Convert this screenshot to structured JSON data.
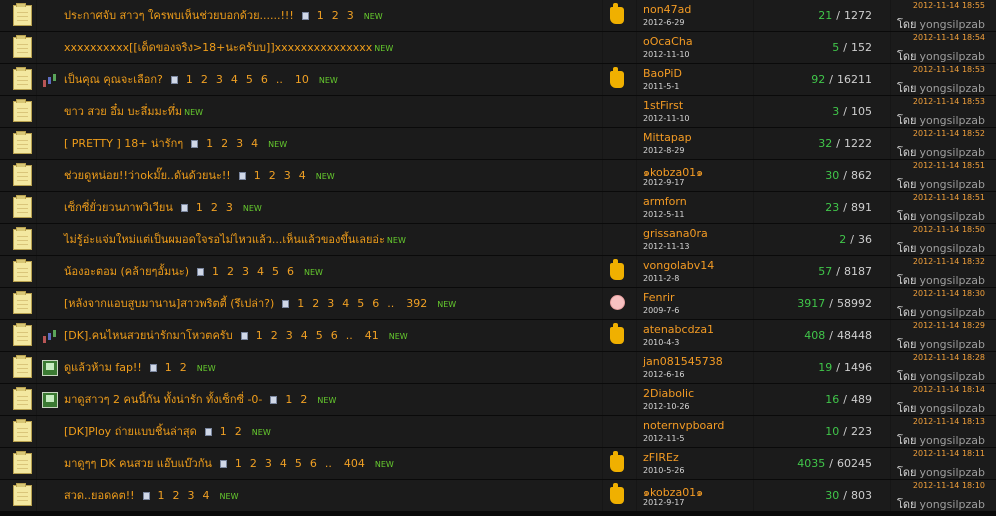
{
  "labels": {
    "by": "โดย",
    "new": "NEW",
    "sep": "/",
    "dots": ".."
  },
  "threads": [
    {
      "title": "ประกาศจับ สาวๆ ใครพบเห็นช่วยบอกด้วย......!!!",
      "pages": [
        "1",
        "2",
        "3"
      ],
      "more_page": "",
      "badge": "",
      "pin": "thumb",
      "author": "non47ad",
      "author_date": "2012-6-29",
      "replies": "21",
      "views": "1272",
      "last_date": "2012-11-14 18:55",
      "last_user": "yongsilpzab"
    },
    {
      "title": "xxxxxxxxxx[[เด็ดของจริง>18+นะครับบ]]xxxxxxxxxxxxxxx",
      "pages": [],
      "more_page": "",
      "badge": "",
      "pin": "",
      "author": "oOcaCha",
      "author_date": "2012-11-10",
      "replies": "5",
      "views": "152",
      "last_date": "2012-11-14 18:54",
      "last_user": "yongsilpzab"
    },
    {
      "title": "เป็นคุณ คุณจะเลือก?",
      "pages": [
        "1",
        "2",
        "3",
        "4",
        "5",
        "6"
      ],
      "more_page": "10",
      "badge": "chart",
      "pin": "thumb",
      "author": "BaoPiD",
      "author_date": "2011-5-1",
      "replies": "92",
      "views": "16211",
      "last_date": "2012-11-14 18:53",
      "last_user": "yongsilpzab"
    },
    {
      "title": "ขาว สวย อึ๋ม บะลึ่มมะทึ่ม",
      "pages": [],
      "more_page": "",
      "badge": "",
      "pin": "",
      "author": "1stFirst",
      "author_date": "2012-11-10",
      "replies": "3",
      "views": "105",
      "last_date": "2012-11-14 18:53",
      "last_user": "yongsilpzab"
    },
    {
      "title": "[ PRETTY ] 18+ น่ารักๆ",
      "pages": [
        "1",
        "2",
        "3",
        "4"
      ],
      "more_page": "",
      "badge": "",
      "pin": "",
      "author": "Mittapap",
      "author_date": "2012-8-29",
      "replies": "32",
      "views": "1222",
      "last_date": "2012-11-14 18:52",
      "last_user": "yongsilpzab"
    },
    {
      "title": "ช่วยดูหน่อย!!ว่าokมั๊ย..ดันด้วยนะ!!",
      "pages": [
        "1",
        "2",
        "3",
        "4"
      ],
      "more_page": "",
      "badge": "",
      "pin": "",
      "author": "๑kobza01๑",
      "author_date": "2012-9-17",
      "replies": "30",
      "views": "862",
      "last_date": "2012-11-14 18:51",
      "last_user": "yongsilpzab"
    },
    {
      "title": "เซ็กซี่ยั่วยวนภาพวิเวียน",
      "pages": [
        "1",
        "2",
        "3"
      ],
      "more_page": "",
      "badge": "",
      "pin": "",
      "author": "armforn",
      "author_date": "2012-5-11",
      "replies": "23",
      "views": "891",
      "last_date": "2012-11-14 18:51",
      "last_user": "yongsilpzab"
    },
    {
      "title": "ไม่รู้อ่ะแจ่มใหม่แต่เป็นผมอดใจรอไม่ไหวแล้ว...เห็นแล้วของขึ้นเลยอ่ะ",
      "pages": [],
      "more_page": "",
      "badge": "",
      "pin": "",
      "author": "grissana0ra",
      "author_date": "2012-11-13",
      "replies": "2",
      "views": "36",
      "last_date": "2012-11-14 18:50",
      "last_user": "yongsilpzab"
    },
    {
      "title": "น้องอะตอม (คล้ายๆอั้มนะ)",
      "pages": [
        "1",
        "2",
        "3",
        "4",
        "5",
        "6"
      ],
      "more_page": "",
      "badge": "",
      "pin": "thumb",
      "author": "vongolabv14",
      "author_date": "2011-2-8",
      "replies": "57",
      "views": "8187",
      "last_date": "2012-11-14 18:32",
      "last_user": "yongsilpzab"
    },
    {
      "title": "[หลังจากแอบสูบมานาน]สาวพริตตี้ (รึเปล่า?)",
      "pages": [
        "1",
        "2",
        "3",
        "4",
        "5",
        "6"
      ],
      "more_page": "392",
      "badge": "",
      "pin": "face",
      "author": "Fenrir",
      "author_date": "2009-7-6",
      "replies": "3917",
      "views": "58992",
      "last_date": "2012-11-14 18:30",
      "last_user": "yongsilpzab"
    },
    {
      "title": "[DK].คนไหนสวยน่ารักมาโหวตครับ",
      "pages": [
        "1",
        "2",
        "3",
        "4",
        "5",
        "6"
      ],
      "more_page": "41",
      "badge": "chart",
      "pin": "thumb",
      "author": "atenabcdza1",
      "author_date": "2010-4-3",
      "replies": "408",
      "views": "48448",
      "last_date": "2012-11-14 18:29",
      "last_user": "yongsilpzab"
    },
    {
      "title": "ดูแล้วห้าม fap!!",
      "pages": [
        "1",
        "2"
      ],
      "more_page": "",
      "badge": "pic",
      "pin": "",
      "author": "jan081545738",
      "author_date": "2012-6-16",
      "replies": "19",
      "views": "1496",
      "last_date": "2012-11-14 18:28",
      "last_user": "yongsilpzab"
    },
    {
      "title": "มาดูสาวๆ 2 คนนี้กัน ทั้งน่ารัก ทั้งเซ็กซี่ -0-",
      "pages": [
        "1",
        "2"
      ],
      "more_page": "",
      "badge": "pic",
      "pin": "",
      "author": "2Diabolic",
      "author_date": "2012-10-26",
      "replies": "16",
      "views": "489",
      "last_date": "2012-11-14 18:14",
      "last_user": "yongsilpzab"
    },
    {
      "title": "[DK]Ploy ถ่ายแบบชิ้นล่าสุด",
      "pages": [
        "1",
        "2"
      ],
      "more_page": "",
      "badge": "",
      "pin": "",
      "author": "noternvpboard",
      "author_date": "2012-11-5",
      "replies": "10",
      "views": "223",
      "last_date": "2012-11-14 18:13",
      "last_user": "yongsilpzab"
    },
    {
      "title": "มาดูๆๆ DK คนสวย แอ๊บแบ๊วกัน",
      "pages": [
        "1",
        "2",
        "3",
        "4",
        "5",
        "6"
      ],
      "more_page": "404",
      "badge": "",
      "pin": "thumb",
      "author": "zFIREz",
      "author_date": "2010-5-26",
      "replies": "4035",
      "views": "60245",
      "last_date": "2012-11-14 18:11",
      "last_user": "yongsilpzab"
    },
    {
      "title": "สวด..ยอดคต!!",
      "pages": [
        "1",
        "2",
        "3",
        "4"
      ],
      "more_page": "",
      "badge": "",
      "pin": "thumb",
      "author": "๑kobza01๑",
      "author_date": "2012-9-17",
      "replies": "30",
      "views": "803",
      "last_date": "2012-11-14 18:10",
      "last_user": "yongsilpzab"
    }
  ]
}
